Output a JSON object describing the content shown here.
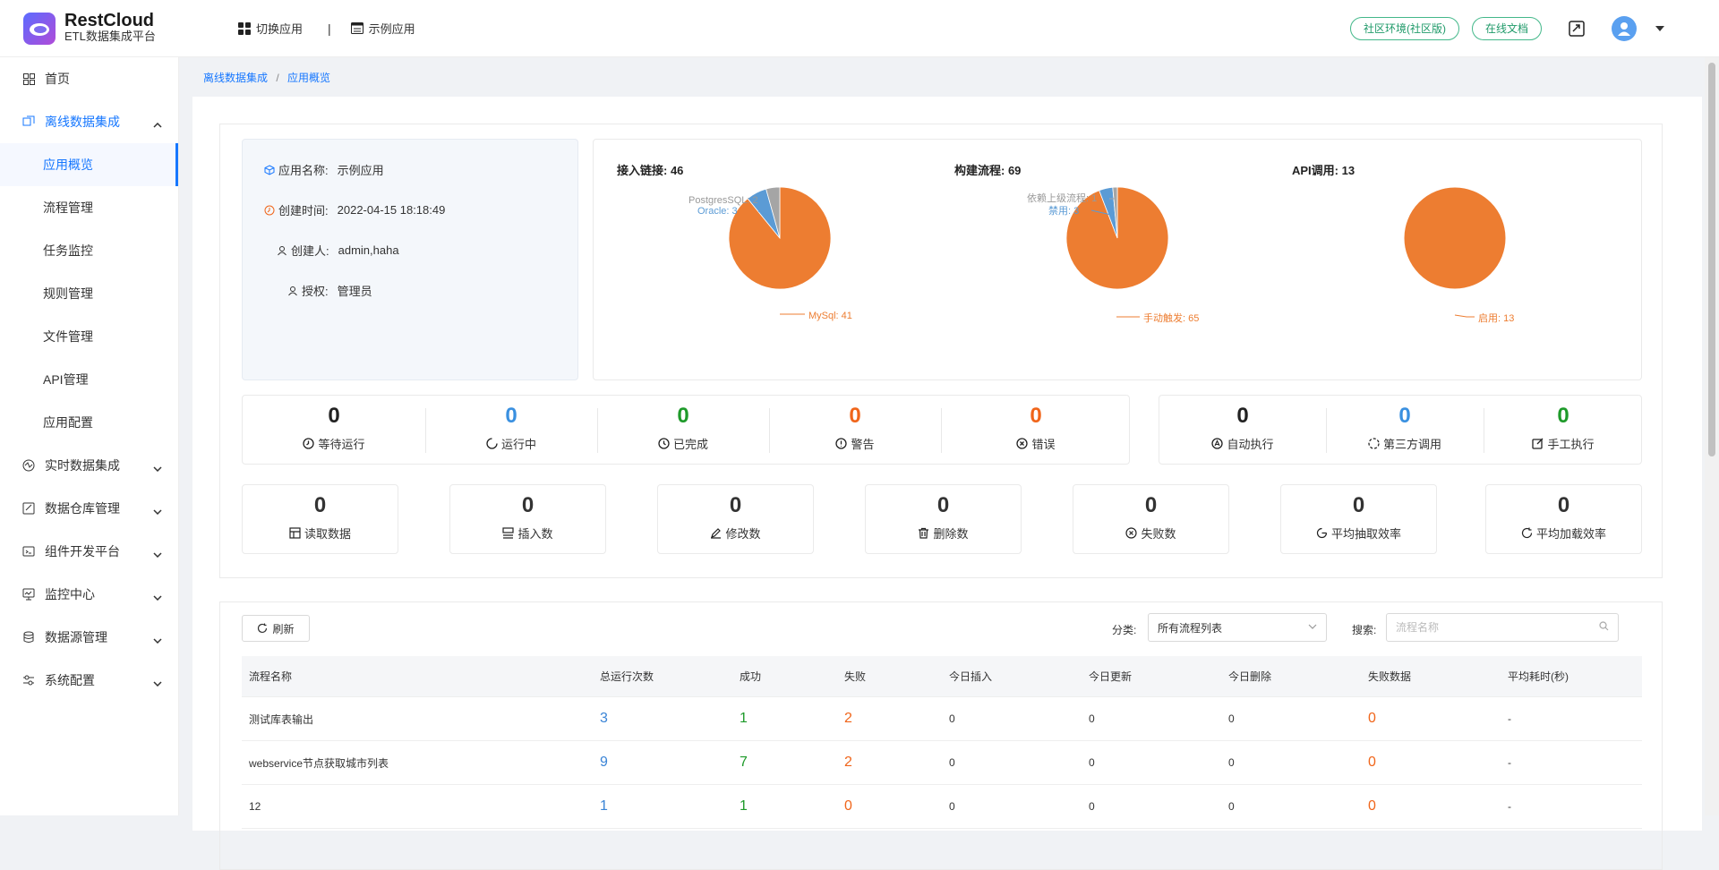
{
  "app": {
    "name": "RestCloud",
    "subtitle": "ETL数据集成平台"
  },
  "header": {
    "switch_app": "切换应用",
    "separator": "|",
    "example_app": "示例应用",
    "env_badge": "社区环境(社区版)",
    "docs_badge": "在线文档"
  },
  "sidebar": {
    "home": "首页",
    "offline": "离线数据集成",
    "sub_items": [
      "应用概览",
      "流程管理",
      "任务监控",
      "规则管理",
      "文件管理",
      "API管理",
      "应用配置"
    ],
    "sections": [
      "实时数据集成",
      "数据仓库管理",
      "组件开发平台",
      "监控中心",
      "数据源管理",
      "系统配置"
    ]
  },
  "breadcrumb": {
    "root": "离线数据集成",
    "sep": "/",
    "current": "应用概览"
  },
  "info": {
    "name_label": "应用名称:",
    "name_value": "示例应用",
    "created_label": "创建时间:",
    "created_value": "2022-04-15 18:18:49",
    "creator_label": "创建人:",
    "creator_value": "admin,haha",
    "auth_label": "授权:",
    "auth_value": "管理员"
  },
  "chart_data": [
    {
      "type": "pie",
      "title": "接入链接: 46",
      "slices": [
        {
          "label": "MySql",
          "value": 41,
          "color": "#ed7d31"
        },
        {
          "label": "Oracle",
          "value": 3,
          "color": "#5b9bd5"
        },
        {
          "label": "PostgresSQL",
          "value": 2,
          "color": "#a5a5a5"
        }
      ]
    },
    {
      "type": "pie",
      "title": "构建流程: 69",
      "slices": [
        {
          "label": "手动触发",
          "value": 65,
          "color": "#ed7d31"
        },
        {
          "label": "禁用",
          "value": 3,
          "color": "#5b9bd5"
        },
        {
          "label": "依赖上级流程",
          "value": 1,
          "color": "#a5a5a5"
        }
      ]
    },
    {
      "type": "pie",
      "title": "API调用: 13",
      "slices": [
        {
          "label": "启用",
          "value": 13,
          "color": "#ed7d31"
        }
      ]
    }
  ],
  "pie_labels": {
    "c1": {
      "mysql": "MySql: 41",
      "oracle": "Oracle: 3",
      "pg": "PostgresSQL: 2"
    },
    "c2": {
      "manual": "手动触发: 65",
      "disabled": "禁用: 3",
      "dep": "依赖上级流程: 1"
    },
    "c3": {
      "enabled": "启用: 13"
    }
  },
  "stats": {
    "pending": {
      "value": "0",
      "label": "等待运行",
      "color": "#222222"
    },
    "running": {
      "value": "0",
      "label": "运行中",
      "color": "#3a90e0"
    },
    "done": {
      "value": "0",
      "label": "已完成",
      "color": "#1e9a2a"
    },
    "warning": {
      "value": "0",
      "label": "警告",
      "color": "#f0651a"
    },
    "error": {
      "value": "0",
      "label": "错误",
      "color": "#f0651a"
    },
    "auto": {
      "value": "0",
      "label": "自动执行",
      "color": "#222222"
    },
    "third": {
      "value": "0",
      "label": "第三方调用",
      "color": "#3a90e0"
    },
    "manual": {
      "value": "0",
      "label": "手工执行",
      "color": "#1e9a2a"
    }
  },
  "cards": [
    {
      "value": "0",
      "label": "读取数据"
    },
    {
      "value": "0",
      "label": "插入数"
    },
    {
      "value": "0",
      "label": "修改数"
    },
    {
      "value": "0",
      "label": "删除数"
    },
    {
      "value": "0",
      "label": "失败数"
    },
    {
      "value": "0",
      "label": "平均抽取效率"
    },
    {
      "value": "0",
      "label": "平均加载效率"
    }
  ],
  "toolbar": {
    "refresh": "刷新",
    "category_label": "分类:",
    "category_value": "所有流程列表",
    "search_label": "搜索:",
    "search_placeholder": "流程名称"
  },
  "table": {
    "headers": [
      "流程名称",
      "总运行次数",
      "成功",
      "失败",
      "今日插入",
      "今日更新",
      "今日删除",
      "失败数据",
      "平均耗时(秒)"
    ],
    "rows": [
      [
        "测试库表输出",
        "3",
        "1",
        "2",
        "0",
        "0",
        "0",
        "0",
        "-"
      ],
      [
        "webservice节点获取城市列表",
        "9",
        "7",
        "2",
        "0",
        "0",
        "0",
        "0",
        "-"
      ],
      [
        "12",
        "1",
        "1",
        "0",
        "0",
        "0",
        "0",
        "0",
        "-"
      ]
    ]
  }
}
